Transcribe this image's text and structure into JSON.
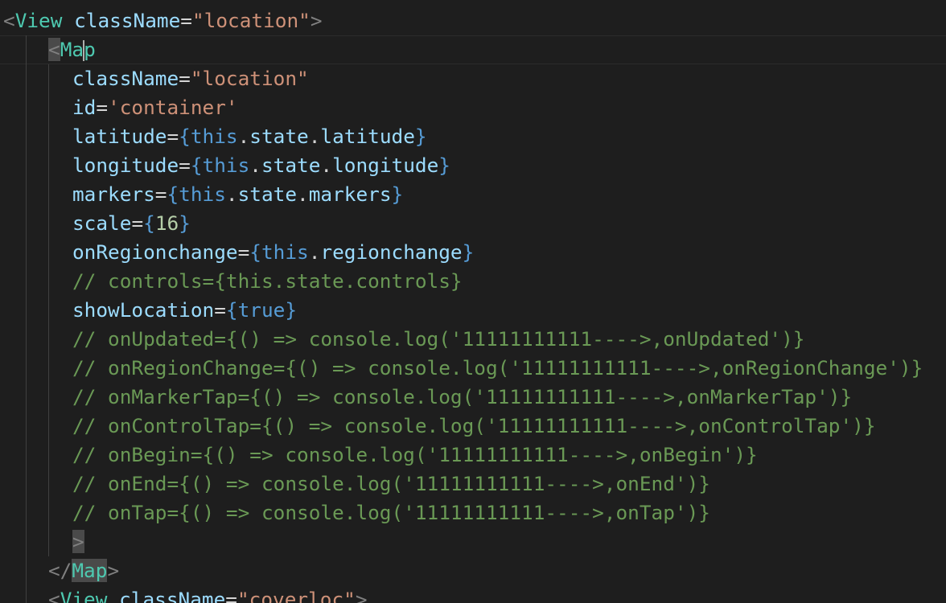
{
  "editor": {
    "lines": [
      [
        {
          "t": "<",
          "c": "punct"
        },
        {
          "t": "View",
          "c": "tag"
        },
        {
          "t": " ",
          "c": "op"
        },
        {
          "t": "className",
          "c": "attr"
        },
        {
          "t": "=",
          "c": "op"
        },
        {
          "t": "\"location\"",
          "c": "str"
        },
        {
          "t": ">",
          "c": "punct"
        }
      ],
      [
        {
          "t": "<",
          "c": "punct",
          "m": 1
        },
        {
          "t": "Ma",
          "c": "tag"
        },
        {
          "t": "p",
          "c": "tag",
          "cur": 1
        }
      ],
      [
        {
          "t": "className",
          "c": "attr"
        },
        {
          "t": "=",
          "c": "op"
        },
        {
          "t": "\"location\"",
          "c": "str"
        }
      ],
      [
        {
          "t": "id",
          "c": "attr"
        },
        {
          "t": "=",
          "c": "op"
        },
        {
          "t": "'container'",
          "c": "str"
        }
      ],
      [
        {
          "t": "latitude",
          "c": "attr"
        },
        {
          "t": "=",
          "c": "op"
        },
        {
          "t": "{",
          "c": "brace"
        },
        {
          "t": "this",
          "c": "kw"
        },
        {
          "t": ".",
          "c": "op"
        },
        {
          "t": "state",
          "c": "attr"
        },
        {
          "t": ".",
          "c": "op"
        },
        {
          "t": "latitude",
          "c": "attr"
        },
        {
          "t": "}",
          "c": "brace"
        }
      ],
      [
        {
          "t": "longitude",
          "c": "attr"
        },
        {
          "t": "=",
          "c": "op"
        },
        {
          "t": "{",
          "c": "brace"
        },
        {
          "t": "this",
          "c": "kw"
        },
        {
          "t": ".",
          "c": "op"
        },
        {
          "t": "state",
          "c": "attr"
        },
        {
          "t": ".",
          "c": "op"
        },
        {
          "t": "longitude",
          "c": "attr"
        },
        {
          "t": "}",
          "c": "brace"
        }
      ],
      [
        {
          "t": "markers",
          "c": "attr"
        },
        {
          "t": "=",
          "c": "op"
        },
        {
          "t": "{",
          "c": "brace"
        },
        {
          "t": "this",
          "c": "kw"
        },
        {
          "t": ".",
          "c": "op"
        },
        {
          "t": "state",
          "c": "attr"
        },
        {
          "t": ".",
          "c": "op"
        },
        {
          "t": "markers",
          "c": "attr"
        },
        {
          "t": "}",
          "c": "brace"
        }
      ],
      [
        {
          "t": "scale",
          "c": "attr"
        },
        {
          "t": "=",
          "c": "op"
        },
        {
          "t": "{",
          "c": "brace"
        },
        {
          "t": "16",
          "c": "num"
        },
        {
          "t": "}",
          "c": "brace"
        }
      ],
      [
        {
          "t": "onRegionchange",
          "c": "attr"
        },
        {
          "t": "=",
          "c": "op"
        },
        {
          "t": "{",
          "c": "brace"
        },
        {
          "t": "this",
          "c": "kw"
        },
        {
          "t": ".",
          "c": "op"
        },
        {
          "t": "regionchange",
          "c": "attr"
        },
        {
          "t": "}",
          "c": "brace"
        }
      ],
      [
        {
          "t": "// controls={this.state.controls}",
          "c": "comment"
        }
      ],
      [
        {
          "t": "showLocation",
          "c": "attr"
        },
        {
          "t": "=",
          "c": "op"
        },
        {
          "t": "{",
          "c": "brace"
        },
        {
          "t": "true",
          "c": "kw"
        },
        {
          "t": "}",
          "c": "brace"
        }
      ],
      [
        {
          "t": "// onUpdated={() => console.log('11111111111---->,onUpdated')}",
          "c": "comment"
        }
      ],
      [
        {
          "t": "// onRegionChange={() => console.log('11111111111---->,onRegionChange')}",
          "c": "comment"
        }
      ],
      [
        {
          "t": "// onMarkerTap={() => console.log('11111111111---->,onMarkerTap')}",
          "c": "comment"
        }
      ],
      [
        {
          "t": "// onControlTap={() => console.log('11111111111---->,onControlTap')}",
          "c": "comment"
        }
      ],
      [
        {
          "t": "// onBegin={() => console.log('11111111111---->,onBegin')}",
          "c": "comment"
        }
      ],
      [
        {
          "t": "// onEnd={() => console.log('11111111111---->,onEnd')}",
          "c": "comment"
        }
      ],
      [
        {
          "t": "// onTap={() => console.log('11111111111---->,onTap')}",
          "c": "comment"
        }
      ],
      [
        {
          "t": ">",
          "c": "punct",
          "m": 1
        }
      ],
      [
        {
          "t": "</",
          "c": "punct"
        },
        {
          "t": "Map",
          "c": "tag",
          "m": 1
        },
        {
          "t": ">",
          "c": "punct"
        }
      ],
      [
        {
          "t": "<",
          "c": "punct"
        },
        {
          "t": "View",
          "c": "tag"
        },
        {
          "t": " ",
          "c": "op"
        },
        {
          "t": "className",
          "c": "attr"
        },
        {
          "t": "=",
          "c": "op"
        },
        {
          "t": "\"coverloc\"",
          "c": "str"
        },
        {
          "t": ">",
          "c": "punct"
        }
      ]
    ]
  },
  "colors": {
    "background": "#1e1e1e",
    "tag": "#4ec9b0",
    "attribute": "#9cdcfe",
    "string": "#ce9178",
    "keyword": "#569cd6",
    "number": "#b5cea8",
    "comment": "#6a9955"
  }
}
